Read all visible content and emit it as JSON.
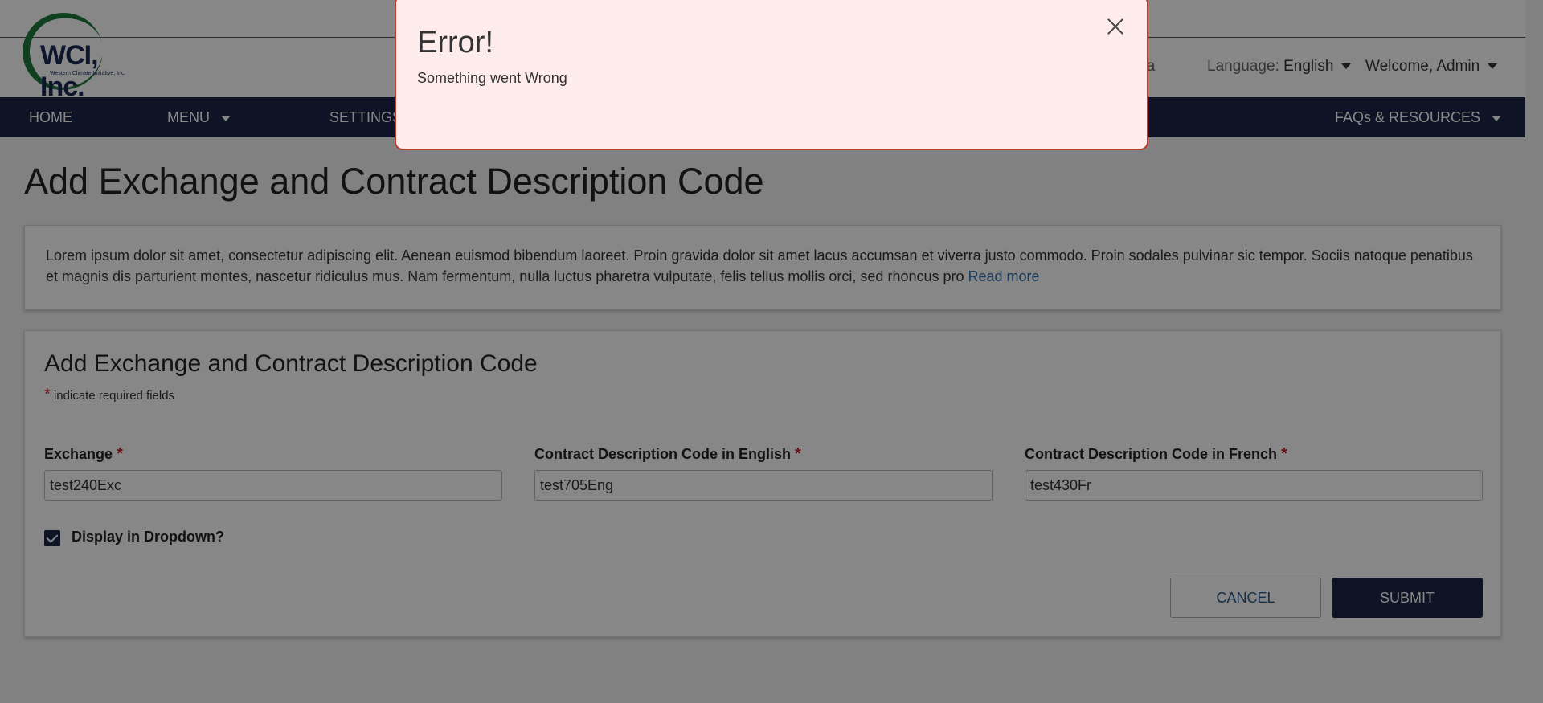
{
  "header": {
    "logo_name": "WCI, Inc.",
    "logo_sub": "Western Climate Initiative, Inc.",
    "jurisdiction_partial": "nia",
    "language_label": "Language:",
    "language_value": "English",
    "welcome": "Welcome, Admin"
  },
  "nav": {
    "items": [
      {
        "label": "HOME"
      },
      {
        "label": "MENU"
      },
      {
        "label": "SETTINGS"
      },
      {
        "label": "FAQs & RESOURCES"
      }
    ]
  },
  "page": {
    "title": "Add Exchange and Contract Description Code",
    "info_text": "Lorem ipsum dolor sit amet, consectetur adipiscing elit. Aenean euismod bibendum laoreet. Proin gravida dolor sit amet lacus accumsan et viverra justo commodo. Proin sodales pulvinar sic tempor. Sociis natoque penatibus et magnis dis parturient montes, nascetur ridiculus mus. Nam fermentum, nulla luctus pharetra vulputate, felis tellus mollis orci, sed rhoncus pro",
    "read_more": "Read more"
  },
  "form": {
    "title": "Add Exchange and Contract Description Code",
    "required_star": "*",
    "required_note": "indicate required fields",
    "fields": [
      {
        "label": "Exchange",
        "value": "test240Exc"
      },
      {
        "label": "Contract Description Code in English",
        "value": "test705Eng"
      },
      {
        "label": "Contract Description Code in French",
        "value": "test430Fr"
      }
    ],
    "checkbox_label": "Display in Dropdown?",
    "checkbox_checked": true,
    "cancel_label": "CANCEL",
    "submit_label": "SUBMIT"
  },
  "modal": {
    "title": "Error!",
    "message": "Something went Wrong"
  },
  "colors": {
    "nav_bg": "#1c2747",
    "modal_bg": "#fdeceb",
    "modal_border": "#c0392b",
    "required": "#c0272d",
    "link": "#2c6fb3"
  }
}
